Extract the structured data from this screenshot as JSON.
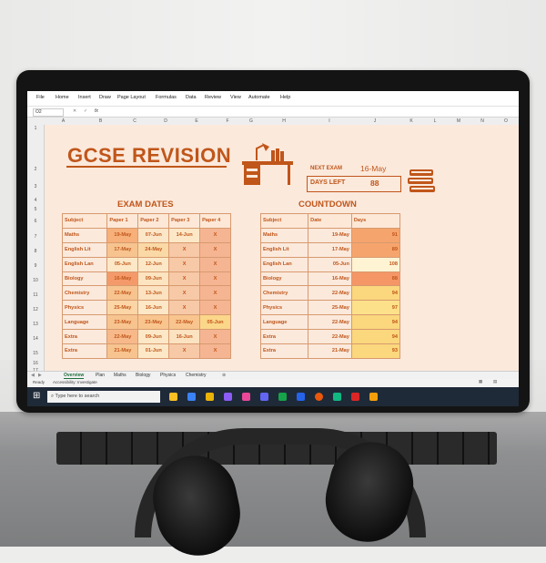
{
  "ribbon_menu": [
    "File",
    "Home",
    "Insert",
    "Draw",
    "Page Layout",
    "Formulas",
    "Data",
    "Review",
    "View",
    "Automate",
    "Help"
  ],
  "formula_bar": {
    "cell_ref": "O2",
    "fx": "fx"
  },
  "columns": [
    "A",
    "B",
    "C",
    "D",
    "E",
    "F",
    "G",
    "H",
    "I",
    "J",
    "K",
    "L",
    "M",
    "N",
    "O"
  ],
  "rows": [
    "1",
    "2",
    "3",
    "4",
    "5",
    "6",
    "7",
    "8",
    "9",
    "10",
    "11",
    "12",
    "13",
    "14",
    "15",
    "16",
    "17"
  ],
  "title": "GCSE REVISION",
  "next_exam": {
    "label": "NEXT EXAM",
    "date": "16-May",
    "days_left_label": "DAYS LEFT",
    "days_left": "88"
  },
  "exam_dates": {
    "heading": "EXAM DATES",
    "headers": [
      "Subject",
      "Paper 1",
      "Paper 2",
      "Paper 3",
      "Paper 4"
    ],
    "rows": [
      [
        "Maths",
        "19-May",
        "07-Jun",
        "14-Jun",
        "X"
      ],
      [
        "English Lit",
        "17-May",
        "24-May",
        "X",
        "X"
      ],
      [
        "English Lan",
        "05-Jun",
        "12-Jun",
        "X",
        "X"
      ],
      [
        "Biology",
        "16-May",
        "09-Jun",
        "X",
        "X"
      ],
      [
        "Chemistry",
        "22-May",
        "13-Jun",
        "X",
        "X"
      ],
      [
        "Physics",
        "25-May",
        "16-Jun",
        "X",
        "X"
      ],
      [
        "Language",
        "23-May",
        "23-May",
        "22-May",
        "05-Jun"
      ],
      [
        "Extra",
        "22-May",
        "09-Jun",
        "16-Jun",
        "X"
      ],
      [
        "Extra",
        "21-May",
        "01-Jun",
        "X",
        "X"
      ]
    ],
    "paper1_colors": [
      "#f7b07a",
      "#f7c490",
      "#fce8c7",
      "#f49a6a",
      "#f7c490",
      "#fbd5a5",
      "#f7c490",
      "#f7b98a",
      "#f7c490"
    ],
    "paper2_colors": [
      "#fbe6c8",
      "#fad9a6",
      "#fce8c7",
      "#fce4c0",
      "#fbe2c0",
      "#fce8c7",
      "#f9c58f",
      "#fce8c7",
      "#fce8c7"
    ],
    "paper3_colors": [
      "#fce8c7",
      "#f7c9a7",
      "#f7c9a7",
      "#f7c9a7",
      "#f7c9a7",
      "#f7c9a7",
      "#f9c58f",
      "#fbe2c0",
      "#f7c9a7"
    ],
    "paper4_colors": [
      "#f5b592",
      "#f5b592",
      "#f5b592",
      "#f5b592",
      "#f5b592",
      "#f5b592",
      "#fbd78a",
      "#f5b592",
      "#f5b592"
    ]
  },
  "countdown": {
    "heading": "COUNTDOWN",
    "headers": [
      "Subject",
      "Date",
      "Days"
    ],
    "rows": [
      [
        "Maths",
        "19-May",
        "91"
      ],
      [
        "English Lit",
        "17-May",
        "89"
      ],
      [
        "English Lan",
        "05-Jun",
        "108"
      ],
      [
        "Biology",
        "16-May",
        "88"
      ],
      [
        "Chemistry",
        "22-May",
        "94"
      ],
      [
        "Physics",
        "25-May",
        "97"
      ],
      [
        "Language",
        "22-May",
        "94"
      ],
      [
        "Extra",
        "22-May",
        "94"
      ],
      [
        "Extra",
        "21-May",
        "93"
      ]
    ],
    "days_colors": [
      "#f6a46d",
      "#f6a46d",
      "#fef4d4",
      "#f59667",
      "#fbd77d",
      "#fce18a",
      "#fbd77d",
      "#fbd77d",
      "#fbd77d"
    ]
  },
  "sheet_tabs": [
    "Overview",
    "Plan",
    "Maths",
    "Biology",
    "Physics",
    "Chemistry"
  ],
  "status": {
    "ready": "Ready",
    "accessibility": "Accessibility: Investigate"
  },
  "taskbar": {
    "search_placeholder": "Type here to search"
  },
  "colors": {
    "accent": "#c0561a",
    "sheet_bg": "#fbe9dc",
    "taskbar": "#1f2a38"
  }
}
